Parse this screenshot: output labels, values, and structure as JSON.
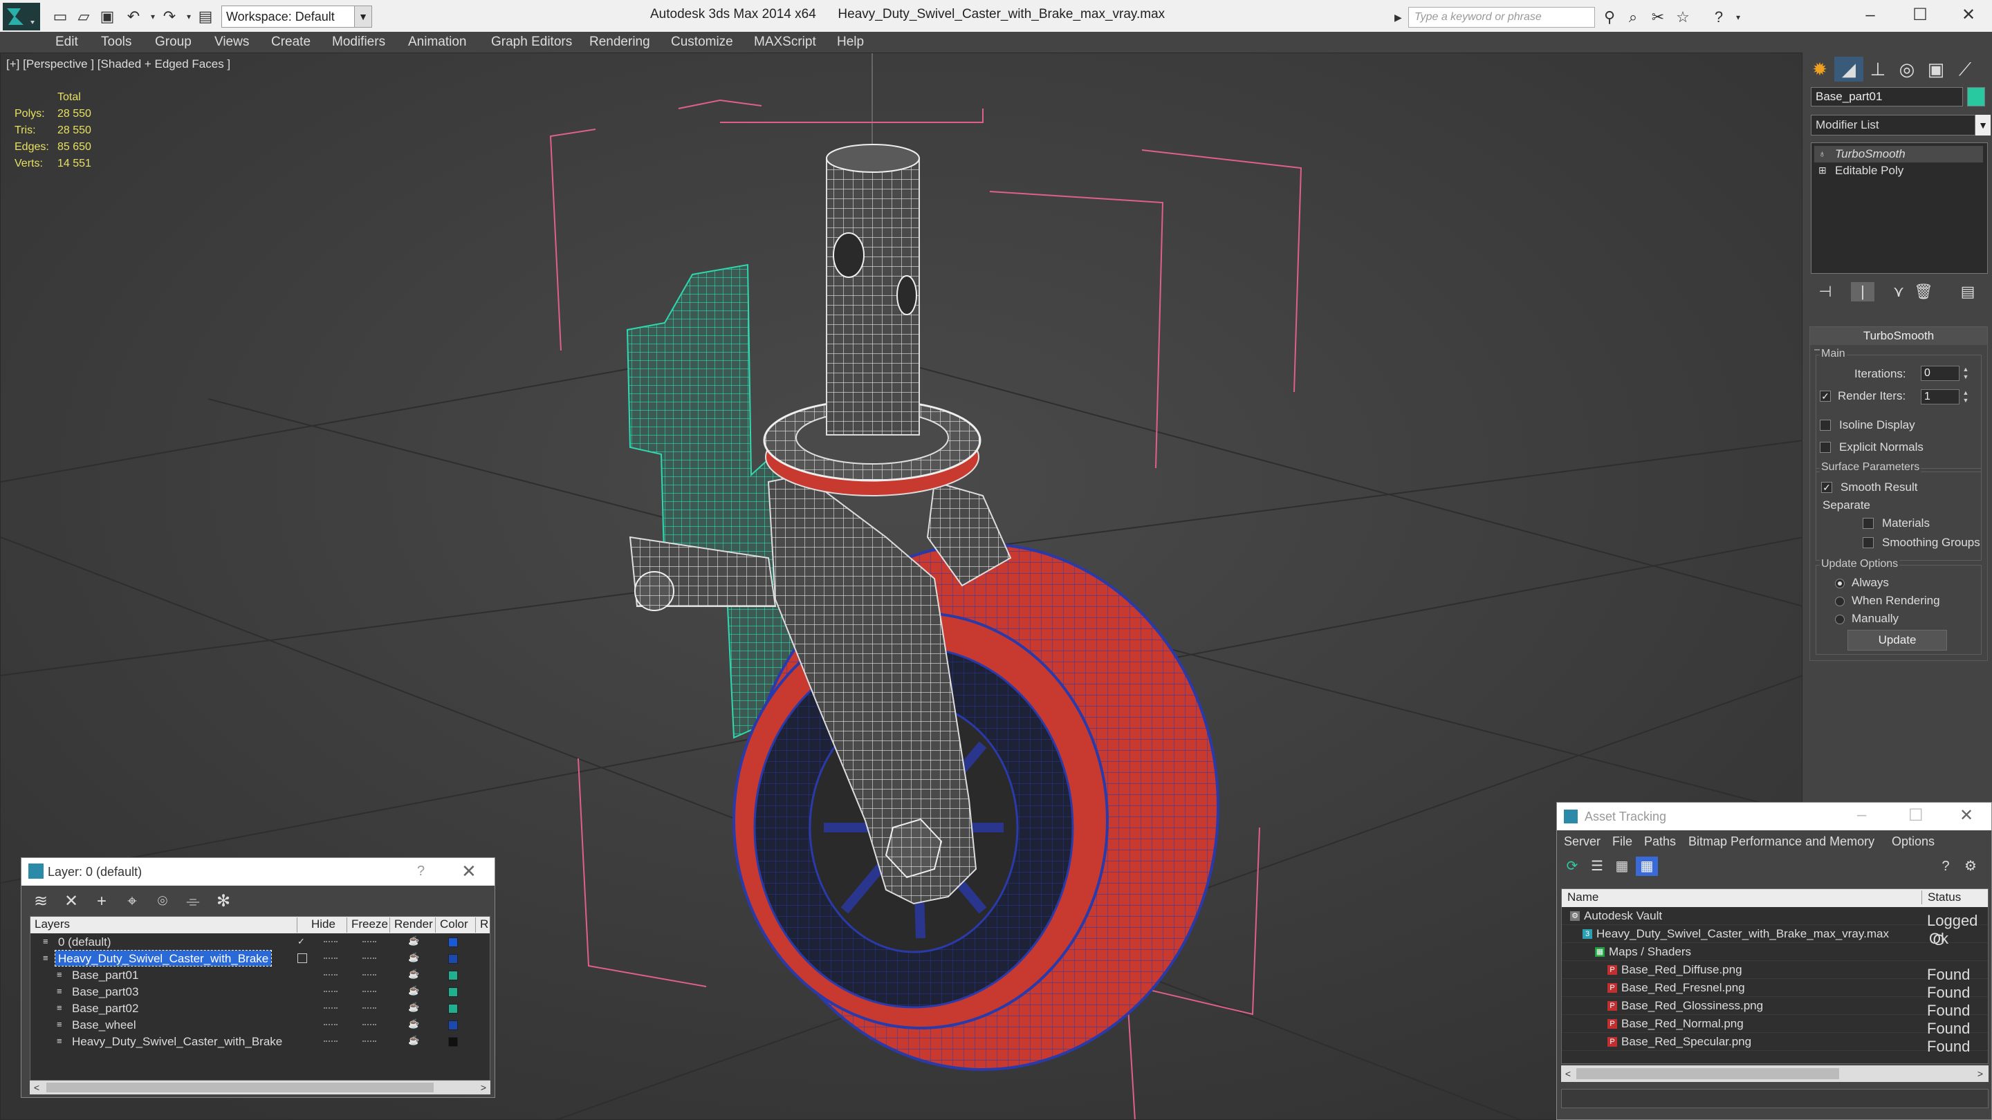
{
  "titlebar": {
    "app_title": "Autodesk 3ds Max 2014 x64      Heavy_Duty_Swivel_Caster_with_Brake_max_vray.max",
    "workspace": "Workspace: Default",
    "search_placeholder": "Type a keyword or phrase"
  },
  "menu": [
    "Edit",
    "Tools",
    "Group",
    "Views",
    "Create",
    "Modifiers",
    "Animation",
    "Graph Editors",
    "Rendering",
    "Customize",
    "MAXScript",
    "Help"
  ],
  "viewport": {
    "label": "[+] [Perspective ] [Shaded + Edged Faces ]",
    "stats_header": "Total",
    "stats": [
      {
        "key": "Polys:",
        "value": "28 550"
      },
      {
        "key": "Tris:",
        "value": "28 550"
      },
      {
        "key": "Edges:",
        "value": "85 650"
      },
      {
        "key": "Verts:",
        "value": "14 551"
      }
    ]
  },
  "command_panel": {
    "object_name": "Base_part01",
    "object_color": "#28c8a0",
    "modifier_list": "Modifier List",
    "stack": [
      "TurboSmooth",
      "Editable Poly"
    ],
    "rollout_title": "TurboSmooth",
    "main_group": "Main",
    "iterations_label": "Iterations:",
    "iterations_value": "0",
    "render_iters_label": "Render Iters:",
    "render_iters_value": "1",
    "render_iters_checked": true,
    "isoline_display": "Isoline Display",
    "explicit_normals": "Explicit Normals",
    "surface_parameters": "Surface Parameters",
    "smooth_result": "Smooth Result",
    "separate": "Separate",
    "materials": "Materials",
    "smoothing_groups": "Smoothing Groups",
    "update_options": "Update Options",
    "always": "Always",
    "when_rendering": "When Rendering",
    "manually": "Manually",
    "update_button": "Update"
  },
  "layer_dialog": {
    "title": "Layer: 0 (default)",
    "help": "?",
    "columns": [
      "Layers",
      "Hide",
      "Freeze",
      "Render",
      "Color",
      "R"
    ],
    "rows": [
      {
        "name": "0 (default)",
        "indent": 0,
        "color": "#1a5ad8",
        "checked": true,
        "selected": false
      },
      {
        "name": "Heavy_Duty_Swivel_Caster_with_Brake",
        "indent": 0,
        "color": "#1a4ab0",
        "checked": false,
        "selected": true
      },
      {
        "name": "Base_part01",
        "indent": 1,
        "color": "#20b090",
        "checked": false,
        "selected": false
      },
      {
        "name": "Base_part03",
        "indent": 1,
        "color": "#20b090",
        "checked": false,
        "selected": false
      },
      {
        "name": "Base_part02",
        "indent": 1,
        "color": "#20b090",
        "checked": false,
        "selected": false
      },
      {
        "name": "Base_wheel",
        "indent": 1,
        "color": "#1a4ab0",
        "checked": false,
        "selected": false
      },
      {
        "name": "Heavy_Duty_Swivel_Caster_with_Brake",
        "indent": 1,
        "color": "#101010",
        "checked": false,
        "selected": false
      }
    ]
  },
  "asset_dialog": {
    "title": "Asset Tracking",
    "menu": [
      "Server",
      "File",
      "Paths",
      "Bitmap Performance and Memory",
      "Options"
    ],
    "columns": [
      "Name",
      "Status"
    ],
    "rows": [
      {
        "name": "Autodesk Vault",
        "status": "Logged O",
        "level": 0,
        "icon": "vault"
      },
      {
        "name": "Heavy_Duty_Swivel_Caster_with_Brake_max_vray.max",
        "status": "Ok",
        "level": 1,
        "icon": "max"
      },
      {
        "name": "Maps / Shaders",
        "status": "",
        "level": 2,
        "icon": "maps"
      },
      {
        "name": "Base_Red_Diffuse.png",
        "status": "Found",
        "level": 3,
        "icon": "png"
      },
      {
        "name": "Base_Red_Fresnel.png",
        "status": "Found",
        "level": 3,
        "icon": "png"
      },
      {
        "name": "Base_Red_Glossiness.png",
        "status": "Found",
        "level": 3,
        "icon": "png"
      },
      {
        "name": "Base_Red_Normal.png",
        "status": "Found",
        "level": 3,
        "icon": "png"
      },
      {
        "name": "Base_Red_Specular.png",
        "status": "Found",
        "level": 3,
        "icon": "png"
      }
    ]
  }
}
